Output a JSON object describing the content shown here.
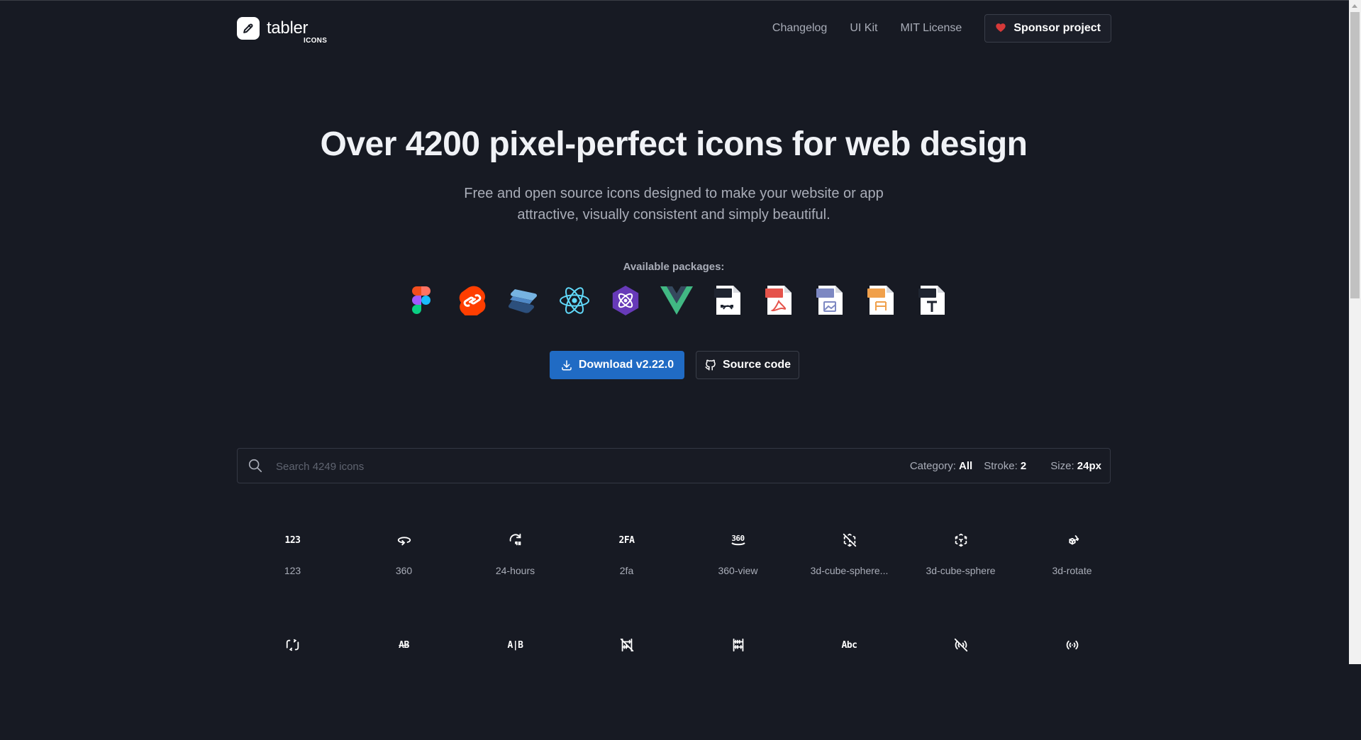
{
  "brand": {
    "name": "tabler",
    "sub": "ICONS"
  },
  "nav": {
    "changelog": "Changelog",
    "ui_kit": "UI Kit",
    "license": "MIT License",
    "sponsor": "Sponsor project"
  },
  "hero": {
    "title": "Over 4200 pixel-perfect icons for web design",
    "subtitle_line1": "Free and open source icons designed to make your website or app",
    "subtitle_line2": "attractive, visually consistent and simply beautiful."
  },
  "packages": {
    "label": "Available packages:",
    "items": [
      "figma-icon",
      "svelte-icon",
      "solidjs-icon",
      "react-icon",
      "preact-icon",
      "vue-icon",
      "svg-file-icon",
      "pdf-file-icon",
      "png-file-icon",
      "eps-file-icon",
      "font-file-icon"
    ],
    "file_tags": {
      "svg": "SVG",
      "pdf": "PDF",
      "png": "PNG",
      "eps": "EPS",
      "font": "FONT",
      "font_glyph": "T"
    }
  },
  "actions": {
    "download": "Download v2.22.0",
    "source": "Source code"
  },
  "search": {
    "placeholder": "Search 4249 icons",
    "category_label": "Category:",
    "category_value": "All",
    "stroke_label": "Stroke:",
    "stroke_value": "2",
    "size_label": "Size:",
    "size_value": "24px"
  },
  "icons_row1": [
    {
      "glyph": "123",
      "label": "123"
    },
    {
      "glyph": "360-icon",
      "label": "360"
    },
    {
      "glyph": "24-hours-icon",
      "label": "24-hours"
    },
    {
      "glyph": "2FA",
      "label": "2fa"
    },
    {
      "glyph": "360",
      "label": "360-view"
    },
    {
      "glyph": "3d-cube-sphere-off-icon",
      "label": "3d-cube-sphere..."
    },
    {
      "glyph": "3d-cube-sphere-icon",
      "label": "3d-cube-sphere"
    },
    {
      "glyph": "3d-rotate-icon",
      "label": "3d-rotate"
    }
  ],
  "icons_row2": [
    {
      "glyph": "a-b-icon"
    },
    {
      "glyph": "AB"
    },
    {
      "glyph": "A|B"
    },
    {
      "glyph": "abacus-off-icon"
    },
    {
      "glyph": "abacus-icon"
    },
    {
      "glyph": "Abc"
    },
    {
      "glyph": "access-point-off-icon"
    },
    {
      "glyph": "access-point-icon"
    }
  ],
  "colors": {
    "background": "#171a23",
    "accent": "#206bc4",
    "heart": "#d63939",
    "muted_text": "#a9adb8"
  }
}
